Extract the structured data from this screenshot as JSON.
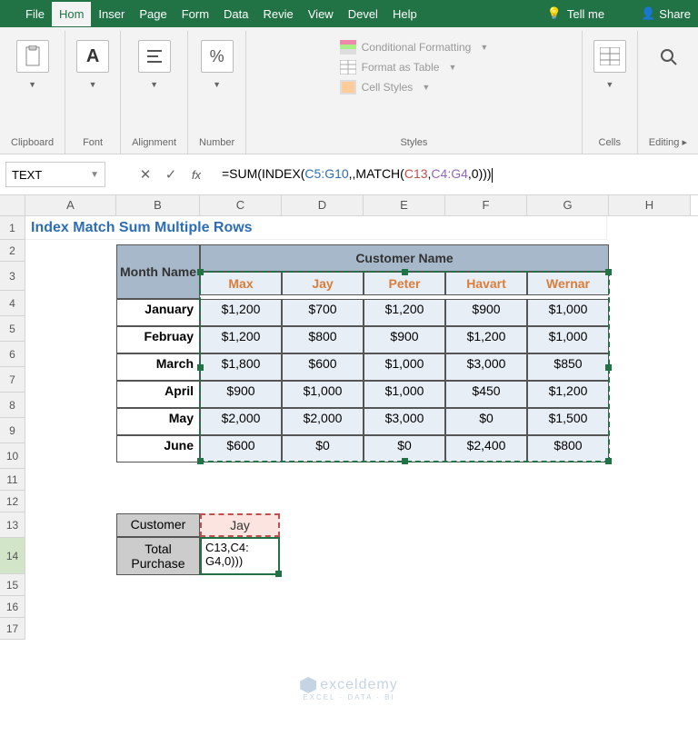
{
  "tabs": {
    "file": "File",
    "home": "Hom",
    "insert": "Inser",
    "page": "Page",
    "form": "Form",
    "data": "Data",
    "review": "Revie",
    "view": "View",
    "devel": "Devel",
    "help": "Help",
    "tellme": "Tell me",
    "share": "Share"
  },
  "ribbon": {
    "clipboard": "Clipboard",
    "font": "Font",
    "alignment": "Alignment",
    "number": "Number",
    "styles": "Styles",
    "cond_fmt": "Conditional Formatting",
    "fmt_table": "Format as Table",
    "cell_styles": "Cell Styles",
    "cells": "Cells",
    "editing": "Editing",
    "percent": "%",
    "font_letter": "A"
  },
  "namebox": "TEXT",
  "formula": {
    "prefix": "=SUM(INDEX(",
    "ref1": "C5:G10",
    "mid1": ",,MATCH(",
    "ref2": "C13",
    "comma": ",",
    "ref3": "C4:G4",
    "suffix": ",0)))"
  },
  "cols": [
    "A",
    "B",
    "C",
    "D",
    "E",
    "F",
    "G",
    "H"
  ],
  "title": "Index Match Sum Multiple Rows",
  "headers": {
    "month": "Month Name",
    "customer": "Customer Name",
    "names": [
      "Max",
      "Jay",
      "Peter",
      "Havart",
      "Wernar"
    ]
  },
  "months": [
    "January",
    "Februay",
    "March",
    "April",
    "May",
    "June"
  ],
  "values": [
    [
      "$1,200",
      "$700",
      "$1,200",
      "$900",
      "$1,000"
    ],
    [
      "$1,200",
      "$800",
      "$900",
      "$1,200",
      "$1,000"
    ],
    [
      "$1,800",
      "$600",
      "$1,000",
      "$3,000",
      "$850"
    ],
    [
      "$900",
      "$1,000",
      "$1,000",
      "$450",
      "$1,200"
    ],
    [
      "$2,000",
      "$2,000",
      "$3,000",
      "$0",
      "$1,500"
    ],
    [
      "$600",
      "$0",
      "$0",
      "$2,400",
      "$800"
    ]
  ],
  "lookup": {
    "customer_lbl": "Customer",
    "customer_val": "Jay",
    "total_lbl1": "Total",
    "total_lbl2": "Purchase",
    "formula_disp1": "C13,C4:",
    "formula_disp2": "G4,0)))"
  },
  "watermark": {
    "brand": "exceldemy",
    "sub": "EXCEL · DATA · BI"
  },
  "chart_data": {
    "type": "table",
    "title": "Index Match Sum Multiple Rows",
    "row_labels": [
      "January",
      "Februay",
      "March",
      "April",
      "May",
      "June"
    ],
    "columns": [
      "Max",
      "Jay",
      "Peter",
      "Havart",
      "Wernar"
    ],
    "data": [
      [
        1200,
        700,
        1200,
        900,
        1000
      ],
      [
        1200,
        800,
        900,
        1200,
        1000
      ],
      [
        1800,
        600,
        1000,
        3000,
        850
      ],
      [
        900,
        1000,
        1000,
        450,
        1200
      ],
      [
        2000,
        2000,
        3000,
        0,
        1500
      ],
      [
        600,
        0,
        0,
        2400,
        800
      ]
    ]
  }
}
